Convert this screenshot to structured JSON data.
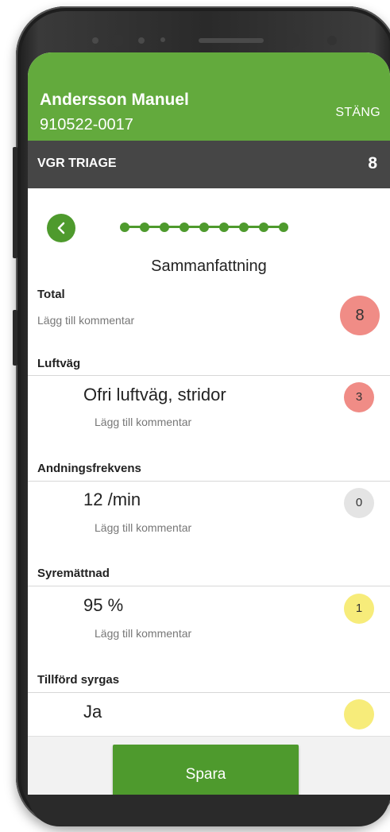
{
  "header": {
    "patient_name": "Andersson Manuel",
    "patient_id": "910522-0017",
    "close_label": "STÄNG",
    "background_color": "#63aa3d"
  },
  "subheader": {
    "title": "VGR TRIAGE",
    "score": "8"
  },
  "nav": {
    "back_icon": "chevron-left-icon",
    "steps_total": 9
  },
  "page_title": "Sammanfattning",
  "total": {
    "label": "Total",
    "comment": "Lägg till kommentar",
    "score": "8",
    "color": "#f08c86"
  },
  "items": [
    {
      "label": "Luftväg",
      "value": "Ofri luftväg, stridor",
      "comment": "Lägg till kommentar",
      "score": "3",
      "color": "#f08c86"
    },
    {
      "label": "Andningsfrekvens",
      "value": "12 /min",
      "comment": "Lägg till kommentar",
      "score": "0",
      "color": "#e4e4e4"
    },
    {
      "label": "Syremättnad",
      "value": "95 %",
      "comment": "Lägg till kommentar",
      "score": "1",
      "color": "#f7ec7a"
    },
    {
      "label": "Tillförd syrgas",
      "value": "Ja",
      "comment": "",
      "score": "",
      "color": "#f7ec7a"
    }
  ],
  "footer": {
    "save_label": "Spara"
  }
}
